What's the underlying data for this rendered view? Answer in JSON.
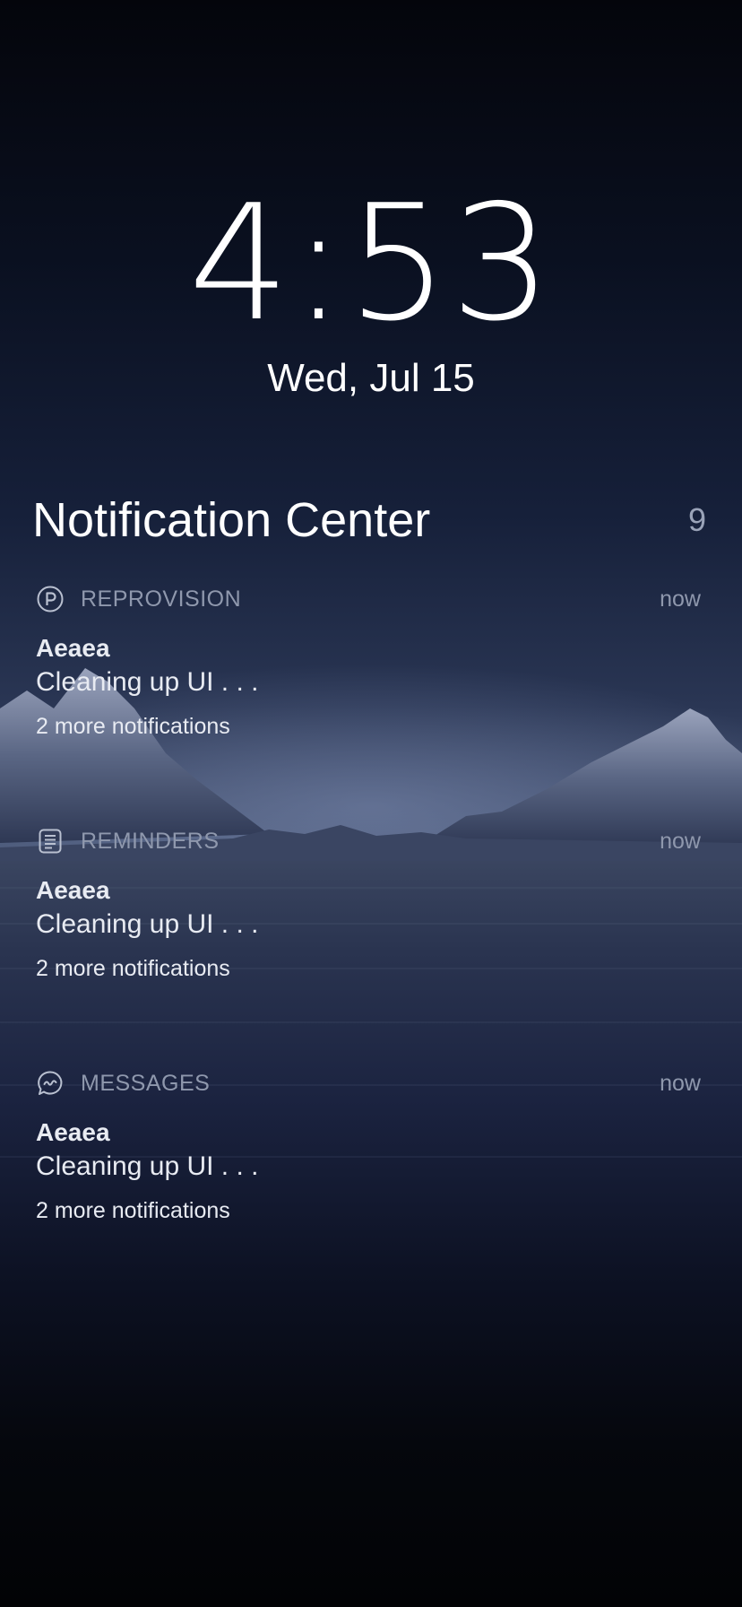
{
  "lock_screen": {
    "time": "4:53",
    "date": "Wed, Jul 15"
  },
  "notification_center": {
    "title": "Notification Center",
    "count": "9",
    "groups": [
      {
        "app_name": "REPROVISION",
        "icon": "reprovision-icon",
        "time": "now",
        "title": "Aeaea",
        "body": "Cleaning up UI . . .",
        "more": "2 more notifications"
      },
      {
        "app_name": "REMINDERS",
        "icon": "reminders-icon",
        "time": "now",
        "title": "Aeaea",
        "body": "Cleaning up UI . . .",
        "more": "2 more notifications"
      },
      {
        "app_name": "MESSAGES",
        "icon": "messages-icon",
        "time": "now",
        "title": "Aeaea",
        "body": "Cleaning up UI . . .",
        "more": "2 more notifications"
      }
    ]
  },
  "colors": {
    "secondary_text": "#8f98ad",
    "primary_text": "#ffffff"
  }
}
